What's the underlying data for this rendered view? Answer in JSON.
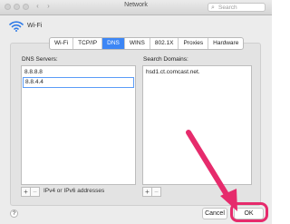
{
  "window": {
    "title": "Network"
  },
  "toolbar": {
    "back_glyph": "‹",
    "forward_glyph": "›",
    "search_placeholder": "Search",
    "search_glyph": "⌕"
  },
  "network": {
    "interface": "Wi-Fi"
  },
  "tabs": [
    {
      "label": "Wi-Fi",
      "active": false
    },
    {
      "label": "TCP/IP",
      "active": false
    },
    {
      "label": "DNS",
      "active": true
    },
    {
      "label": "WINS",
      "active": false
    },
    {
      "label": "802.1X",
      "active": false
    },
    {
      "label": "Proxies",
      "active": false
    },
    {
      "label": "Hardware",
      "active": false
    }
  ],
  "dns": {
    "label": "DNS Servers:",
    "servers": [
      "8.8.8.8",
      "8.8.4.4"
    ],
    "hint": "IPv4 or IPv6 addresses",
    "add_glyph": "+",
    "remove_glyph": "−"
  },
  "search_domains": {
    "label": "Search Domains:",
    "domains": [
      "hsd1.ct.comcast.net."
    ],
    "add_glyph": "+",
    "remove_glyph": "−"
  },
  "footer": {
    "help_glyph": "?",
    "cancel_label": "Cancel",
    "ok_label": "OK"
  },
  "annotation": {
    "color": "#e62b6c",
    "icon": "pointer-arrow"
  },
  "colors": {
    "accent": "#3d86f5",
    "annotation": "#e62b6c"
  }
}
